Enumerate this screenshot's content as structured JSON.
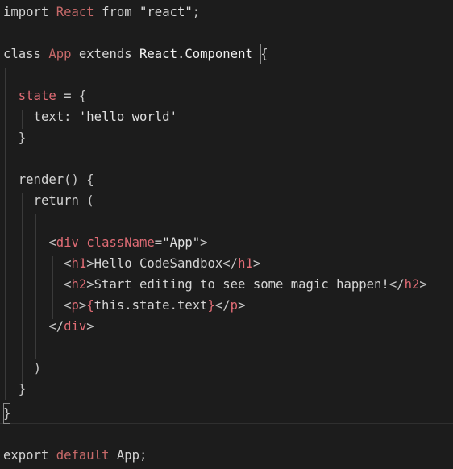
{
  "editor": {
    "language": "javascript",
    "theme": "dark",
    "lines": [
      "import React from \"react\";",
      "",
      "class App extends React.Component {",
      "",
      "  state = {",
      "    text: 'hello world'",
      "  }",
      "",
      "  render() {",
      "    return (",
      "",
      "      <div className=\"App\">",
      "        <h1>Hello CodeSandbox</h1>",
      "        <h2>Start editing to see some magic happen!</h2>",
      "        <p>{this.state.text}</p>",
      "      </div>",
      "",
      "    )",
      "  }",
      "}",
      "",
      "export default App;"
    ]
  },
  "tokens": {
    "l1": {
      "import": "import",
      "react": "React",
      "from": "from",
      "src": "\"react\"",
      "semi": ";"
    },
    "l3": {
      "class": "class",
      "name": "App",
      "extends": "extends",
      "base": "React.Component",
      "brace": "{"
    },
    "l5": {
      "prop": "state",
      "eq": " = ",
      "brace": "{"
    },
    "l6": {
      "key": "text",
      "colon": ":",
      "val": "'hello world'"
    },
    "l7": {
      "brace": "}"
    },
    "l9": {
      "method": "render",
      "paren": "() {"
    },
    "l10": {
      "ret": "return",
      "paren": "("
    },
    "l12": {
      "open": "<",
      "tag": "div",
      "attr": "className",
      "eq": "=",
      "val": "\"App\"",
      "close": ">"
    },
    "l13": {
      "open": "<",
      "tag": "h1",
      "close": ">",
      "text": "Hello CodeSandbox",
      "end_open": "</",
      "end_tag": "h1",
      "end_close": ">"
    },
    "l14": {
      "open": "<",
      "tag": "h2",
      "close": ">",
      "text": "Start editing to see some magic happen!",
      "end_open": "</",
      "end_tag": "h2",
      "end_close": ">"
    },
    "l15": {
      "open": "<",
      "tag": "p",
      "close": ">",
      "lb": "{",
      "expr": "this.state.text",
      "rb": "}",
      "end_open": "</",
      "end_tag": "p",
      "end_close": ">"
    },
    "l16": {
      "end_open": "</",
      "end_tag": "div",
      "end_close": ">"
    },
    "l18": {
      "paren": ")"
    },
    "l19": {
      "brace": "}"
    },
    "l20": {
      "brace": "}"
    },
    "l22": {
      "export": "export",
      "default": "default",
      "name": "App",
      "semi": ";"
    }
  }
}
